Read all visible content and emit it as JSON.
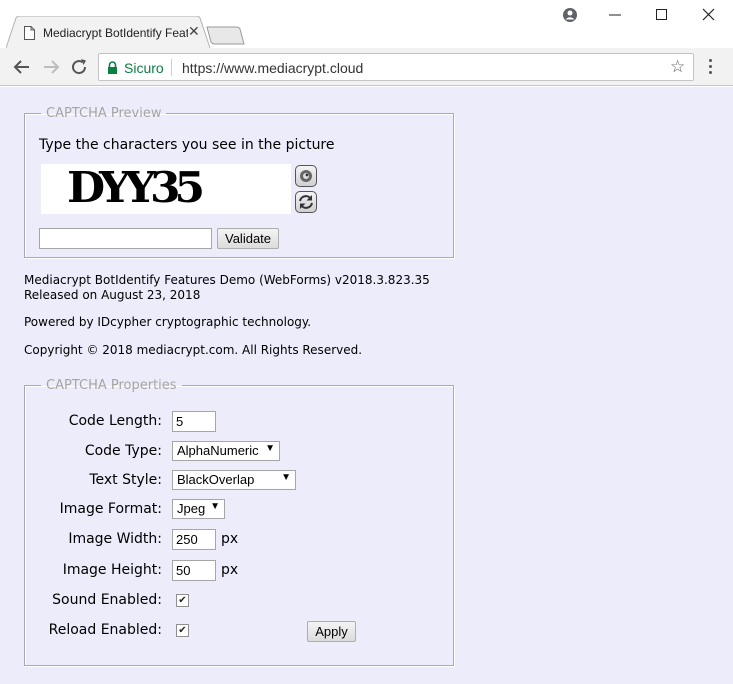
{
  "browser": {
    "tab_title": "Mediacrypt BotIdentify Features Demo",
    "secure_label": "Sicuro",
    "url": "https://www.mediacrypt.cloud"
  },
  "preview": {
    "legend": "CAPTCHA Preview",
    "instruction": "Type the characters you see in the picture",
    "captcha_text": "DYY35",
    "input_value": "",
    "validate_label": "Validate"
  },
  "info": {
    "line1": "Mediacrypt BotIdentify Features Demo (WebForms) v2018.3.823.35",
    "line2": "Released on August 23, 2018",
    "powered": "Powered by IDcypher cryptographic technology.",
    "copyright": "Copyright © 2018 mediacrypt.com. All Rights Reserved."
  },
  "properties": {
    "legend": "CAPTCHA Properties",
    "code_length_label": "Code Length:",
    "code_length_value": "5",
    "code_type_label": "Code Type:",
    "code_type_value": "AlphaNumeric",
    "text_style_label": "Text Style:",
    "text_style_value": "BlackOverlap",
    "image_format_label": "Image Format:",
    "image_format_value": "Jpeg",
    "image_width_label": "Image Width:",
    "image_width_value": "250",
    "image_height_label": "Image Height:",
    "image_height_value": "50",
    "unit": "px",
    "sound_label": "Sound Enabled:",
    "sound_checked": true,
    "reload_label": "Reload Enabled:",
    "reload_checked": true,
    "apply_label": "Apply"
  },
  "colors": {
    "page_background": "#ececfb",
    "secure_green": "#0b8043",
    "legend_gray": "#a5a5a5"
  }
}
